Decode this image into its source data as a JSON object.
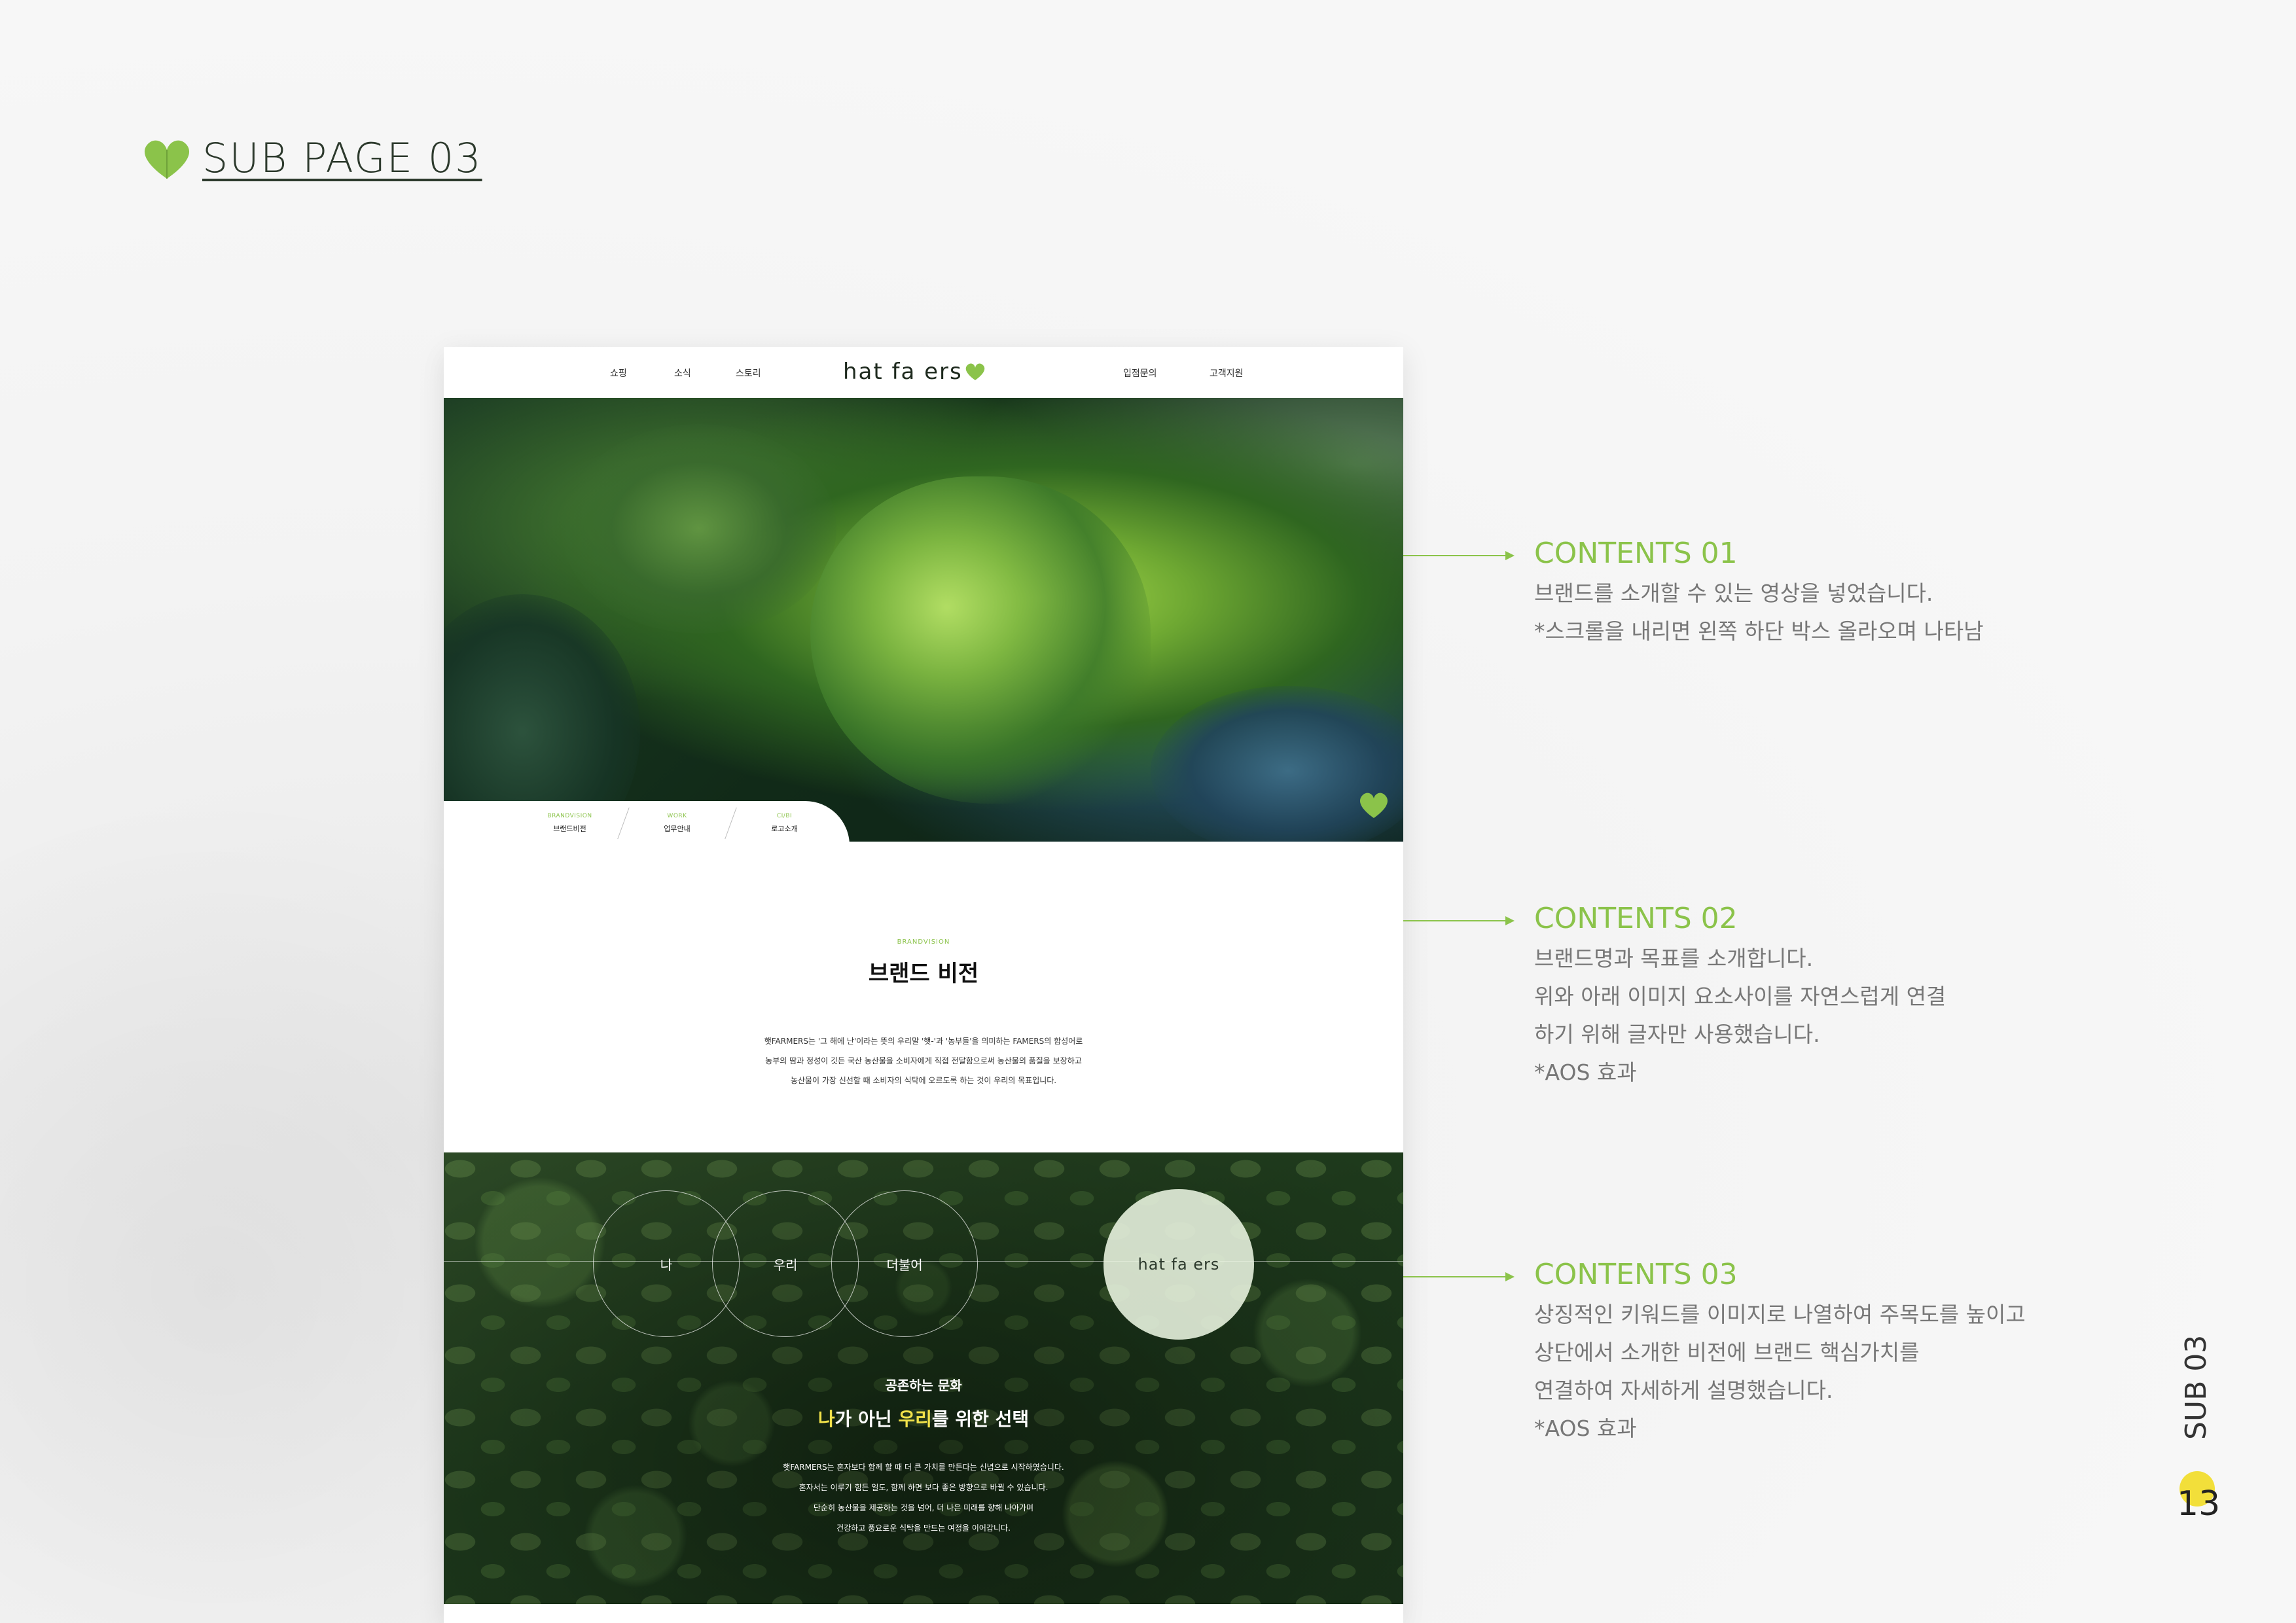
{
  "page": {
    "title": "SUB PAGE 03",
    "side_label": "SUB 03",
    "page_number": "13"
  },
  "mock": {
    "nav": {
      "left_links": [
        "쇼핑",
        "소식",
        "스토리"
      ],
      "logo": "hat fa ers",
      "right_links": [
        "입점문의",
        "고객지원"
      ]
    },
    "hero_tabs": [
      {
        "en": "BRANDVISION",
        "ko": "브랜드비전"
      },
      {
        "en": "WORK",
        "ko": "업무안내"
      },
      {
        "en": "CI/BI",
        "ko": "로고소개"
      }
    ],
    "vision": {
      "eyebrow": "BRANDVISION",
      "title": "브랜드 비전",
      "body": [
        "햇FARMERS는 '그 해에 난'이라는 뜻의 우리말 '햇-'과 '농부들'을 의미하는 FAMERS의 합성어로",
        "농부의 땀과 정성이 깃든 국산 농산물을 소비자에게 직접 전달함으로써 농산물의 품질을 보장하고",
        "농산물이 가장 신선할 때 소비자의 식탁에 오르도록 하는 것이 우리의 목표입니다."
      ]
    },
    "values": {
      "circles": [
        "나",
        "우리",
        "더불어"
      ],
      "logo": "hat fa ers",
      "sub": "공존하는 문화",
      "head_pre1": "나",
      "head_mid": "가 아닌 ",
      "head_pre2": "우리",
      "head_post": "를 위한 선택",
      "body": [
        "햇FARMERS는 혼자보다 함께 할 때 더 큰 가치를 만든다는 신념으로 시작하였습니다.",
        "혼자서는 이루기 힘든 일도, 함께 하면 보다 좋은 방향으로 바뀔 수 있습니다.",
        "단순히 농산물을 제공하는 것을 넘어, 더 나은 미래를 향해 나아가며",
        "건강하고 풍요로운 식탁을 만드는 여정을 이어갑니다."
      ]
    }
  },
  "annotations": [
    {
      "title": "CONTENTS 01",
      "lines": [
        "브랜드를 소개할 수 있는 영상을 넣었습니다.",
        "*스크롤을 내리면 왼쪽 하단 박스 올라오며 나타남"
      ]
    },
    {
      "title": "CONTENTS 02",
      "lines": [
        "브랜드명과 목표를 소개합니다.",
        "위와 아래 이미지 요소사이를 자연스럽게 연결",
        "하기 위해 글자만 사용했습니다.",
        "*AOS 효과"
      ]
    },
    {
      "title": "CONTENTS 03",
      "lines": [
        "상징적인 키워드를 이미지로 나열하여 주목도를 높이고",
        "상단에서 소개한 비전에 브랜드 핵심가치를",
        "연결하여 자세하게 설명했습니다.",
        "*AOS 효과"
      ]
    }
  ],
  "colors": {
    "accent": "#8bc34a",
    "highlight": "#f2e24a",
    "page_dot": "#f2df3a"
  },
  "icons": {
    "header": "heart-leaf-icon",
    "hero_corner": "heart-leaf-icon"
  }
}
